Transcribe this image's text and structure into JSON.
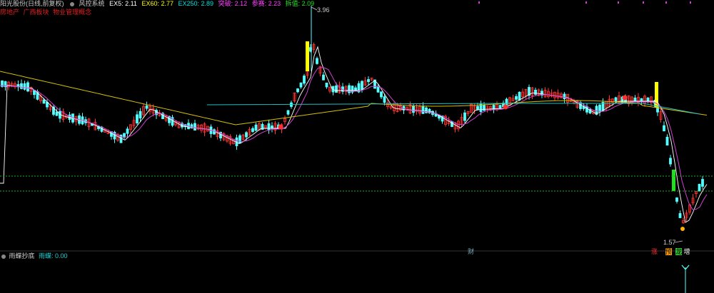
{
  "legend": {
    "stock_title": "阳光股份(日线,前复权)",
    "indicator_name": "风控系统",
    "items": [
      {
        "label": "EX5: 2.11",
        "color": "#ffffff"
      },
      {
        "label": "EX60: 2.77",
        "color": "#ffff00"
      },
      {
        "label": "EX250: 2.89",
        "color": "#00e0e0"
      },
      {
        "label": "突破: 2.12",
        "color": "#ff40ff"
      },
      {
        "label": "参赛: 2.23",
        "color": "#ff40ff"
      },
      {
        "label": "拆值: 2.09",
        "color": "#20e020"
      }
    ]
  },
  "tags": [
    {
      "label": "房地产",
      "color": "#e02020"
    },
    {
      "label": "广西板块",
      "color": "#e02020"
    },
    {
      "label": "物业管理概念",
      "color": "#e02020"
    }
  ],
  "sub_panel": {
    "name": "雨蝶抄底",
    "value_label": "雨蝶: 0.00"
  },
  "annotations": {
    "high": "3.96",
    "low": "1.57",
    "fin_marker": "财",
    "signals": [
      {
        "label": "涨",
        "color": "#ff3030",
        "bg": "#000"
      },
      {
        "label": "预",
        "color": "#000",
        "bg": "#ffa000"
      },
      {
        "label": "龙",
        "color": "#000",
        "bg": "#30c030"
      },
      {
        "label": "增",
        "color": "#fff",
        "bg": "#000"
      }
    ]
  },
  "colors": {
    "up": "#ff3232",
    "down": "#54ffff",
    "ma_white": "#ffffff",
    "ma_yellow": "#d4c000",
    "ma_cyan": "#20c0c0",
    "ma_magenta": "#d040d0",
    "dotted_green": "#20b020"
  }
}
